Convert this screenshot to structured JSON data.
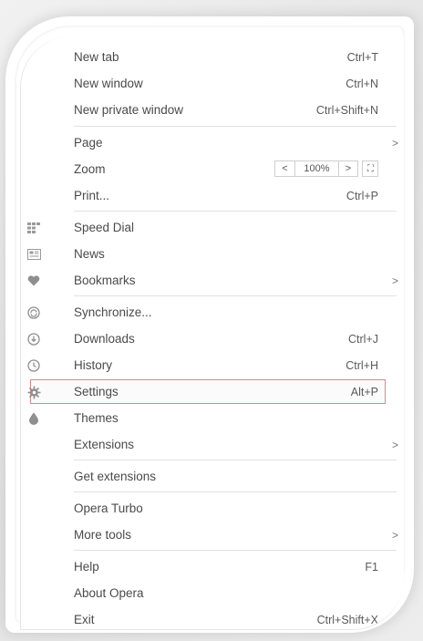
{
  "menu": {
    "items": {
      "new_tab": {
        "label": "New tab",
        "shortcut": "Ctrl+T"
      },
      "new_window": {
        "label": "New window",
        "shortcut": "Ctrl+N"
      },
      "new_private_window": {
        "label": "New private window",
        "shortcut": "Ctrl+Shift+N"
      },
      "page": {
        "label": "Page"
      },
      "zoom": {
        "label": "Zoom",
        "decrease": "<",
        "value": "100%",
        "increase": ">",
        "fullscreen": "⛶"
      },
      "print": {
        "label": "Print...",
        "shortcut": "Ctrl+P"
      },
      "speed_dial": {
        "label": "Speed Dial",
        "icon": "speed-dial-icon"
      },
      "news": {
        "label": "News",
        "icon": "news-icon"
      },
      "bookmarks": {
        "label": "Bookmarks",
        "icon": "heart-icon"
      },
      "synchronize": {
        "label": "Synchronize...",
        "icon": "sync-icon"
      },
      "downloads": {
        "label": "Downloads",
        "shortcut": "Ctrl+J",
        "icon": "download-icon"
      },
      "history": {
        "label": "History",
        "shortcut": "Ctrl+H",
        "icon": "clock-icon"
      },
      "settings": {
        "label": "Settings",
        "shortcut": "Alt+P",
        "icon": "gear-icon"
      },
      "themes": {
        "label": "Themes",
        "icon": "drop-icon"
      },
      "extensions": {
        "label": "Extensions"
      },
      "get_extensions": {
        "label": "Get extensions"
      },
      "opera_turbo": {
        "label": "Opera Turbo"
      },
      "more_tools": {
        "label": "More tools"
      },
      "help": {
        "label": "Help",
        "shortcut": "F1"
      },
      "about_opera": {
        "label": "About Opera"
      },
      "exit": {
        "label": "Exit",
        "shortcut": "Ctrl+Shift+X"
      }
    },
    "submenu_arrow": ">",
    "highlight_color": "#d88a8a"
  }
}
